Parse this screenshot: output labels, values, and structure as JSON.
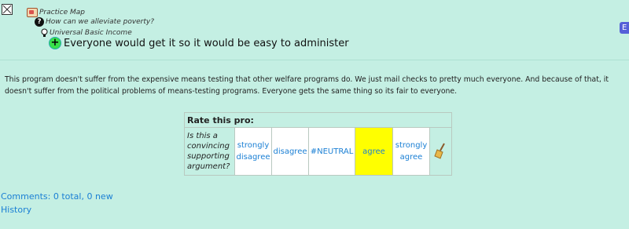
{
  "breadcrumb": {
    "map_label": "Practice Map",
    "question_label": "How can we alleviate poverty?",
    "position_label": "Universal Basic Income"
  },
  "claim": {
    "title": "Everyone would get it so it would be easy to administer"
  },
  "side_button_label": "E",
  "body_text": "This program doesn't suffer from the expensive means testing that other welfare programs do. We just mail checks to pretty much everyone. And because of that, it doesn't suffer from the political problems of means-testing programs. Everyone gets the same thing so its fair to everyone.",
  "rating": {
    "header": "Rate this pro:",
    "question": "Is this a convincing supporting argument?",
    "options": [
      "strongly disagree",
      "disagree",
      "#NEUTRAL",
      "agree",
      "strongly agree"
    ],
    "selected": "agree"
  },
  "links": {
    "comments": "Comments: 0 total, 0 new",
    "history": "History"
  },
  "colors": {
    "background": "#c4efe3",
    "link": "#1a7fd4",
    "selected_option": "#ffff00",
    "pro_icon": "#39e04a"
  },
  "icons": [
    "close-icon",
    "map-icon",
    "question-icon",
    "lightbulb-icon",
    "pro-plus-icon",
    "broom-icon"
  ]
}
